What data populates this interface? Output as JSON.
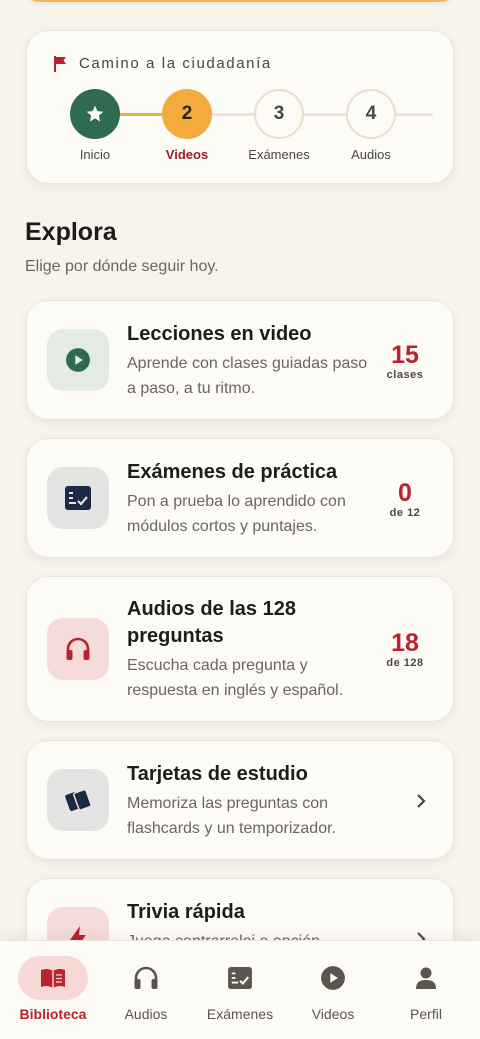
{
  "progress": {
    "title": "Camino a la ciudadanía",
    "steps": [
      {
        "label": "Inicio",
        "number": "",
        "state": "done"
      },
      {
        "label": "Videos",
        "number": "2",
        "state": "current"
      },
      {
        "label": "Exámenes",
        "number": "3",
        "state": "upcoming"
      },
      {
        "label": "Audios",
        "number": "4",
        "state": "upcoming"
      }
    ]
  },
  "explore": {
    "title": "Explora",
    "subtitle": "Elige por dónde seguir hoy."
  },
  "features": [
    {
      "title": "Lecciones en video",
      "title2": "",
      "desc1": "Aprende con clases guiadas paso",
      "desc2": "a paso, a tu ritmo.",
      "stat": "15",
      "stat_unit": "clases",
      "icon": "play-icon"
    },
    {
      "title": "Exámenes de práctica",
      "title2": "",
      "desc1": "Pon a prueba lo aprendido con",
      "desc2": "módulos cortos y puntajes.",
      "stat": "0",
      "stat_unit": "de 12",
      "icon": "checklist-icon"
    },
    {
      "title": "Audios de las 128",
      "title2": "preguntas",
      "desc1": "Escucha cada pregunta y",
      "desc2": "respuesta en inglés y español.",
      "stat": "18",
      "stat_unit": "de 128",
      "icon": "headphones-icon"
    },
    {
      "title": "Tarjetas de estudio",
      "title2": "",
      "desc1": "Memoriza las preguntas con",
      "desc2": "flashcards y un temporizador.",
      "stat": "",
      "stat_unit": "",
      "icon": "cards-icon"
    },
    {
      "title": "Trivia rápida",
      "title2": "",
      "desc1": "Juega contrarreloj o opción",
      "desc2": "",
      "stat": "",
      "stat_unit": "",
      "icon": "bolt-icon"
    }
  ],
  "nav": {
    "items": [
      {
        "label": "Biblioteca",
        "icon": "book-icon",
        "active": true
      },
      {
        "label": "Audios",
        "icon": "headphones-icon",
        "active": false
      },
      {
        "label": "Exámenes",
        "icon": "checklist-icon",
        "active": false
      },
      {
        "label": "Videos",
        "icon": "play-circle-icon",
        "active": false
      },
      {
        "label": "Perfil",
        "icon": "person-icon",
        "active": false
      }
    ]
  },
  "colors": {
    "background": "#f7f4ec",
    "card": "#fdfbf6",
    "green": "#2e6b4f",
    "orange": "#f2ab3c",
    "red": "#b8232f",
    "navy": "#1d2a44"
  }
}
